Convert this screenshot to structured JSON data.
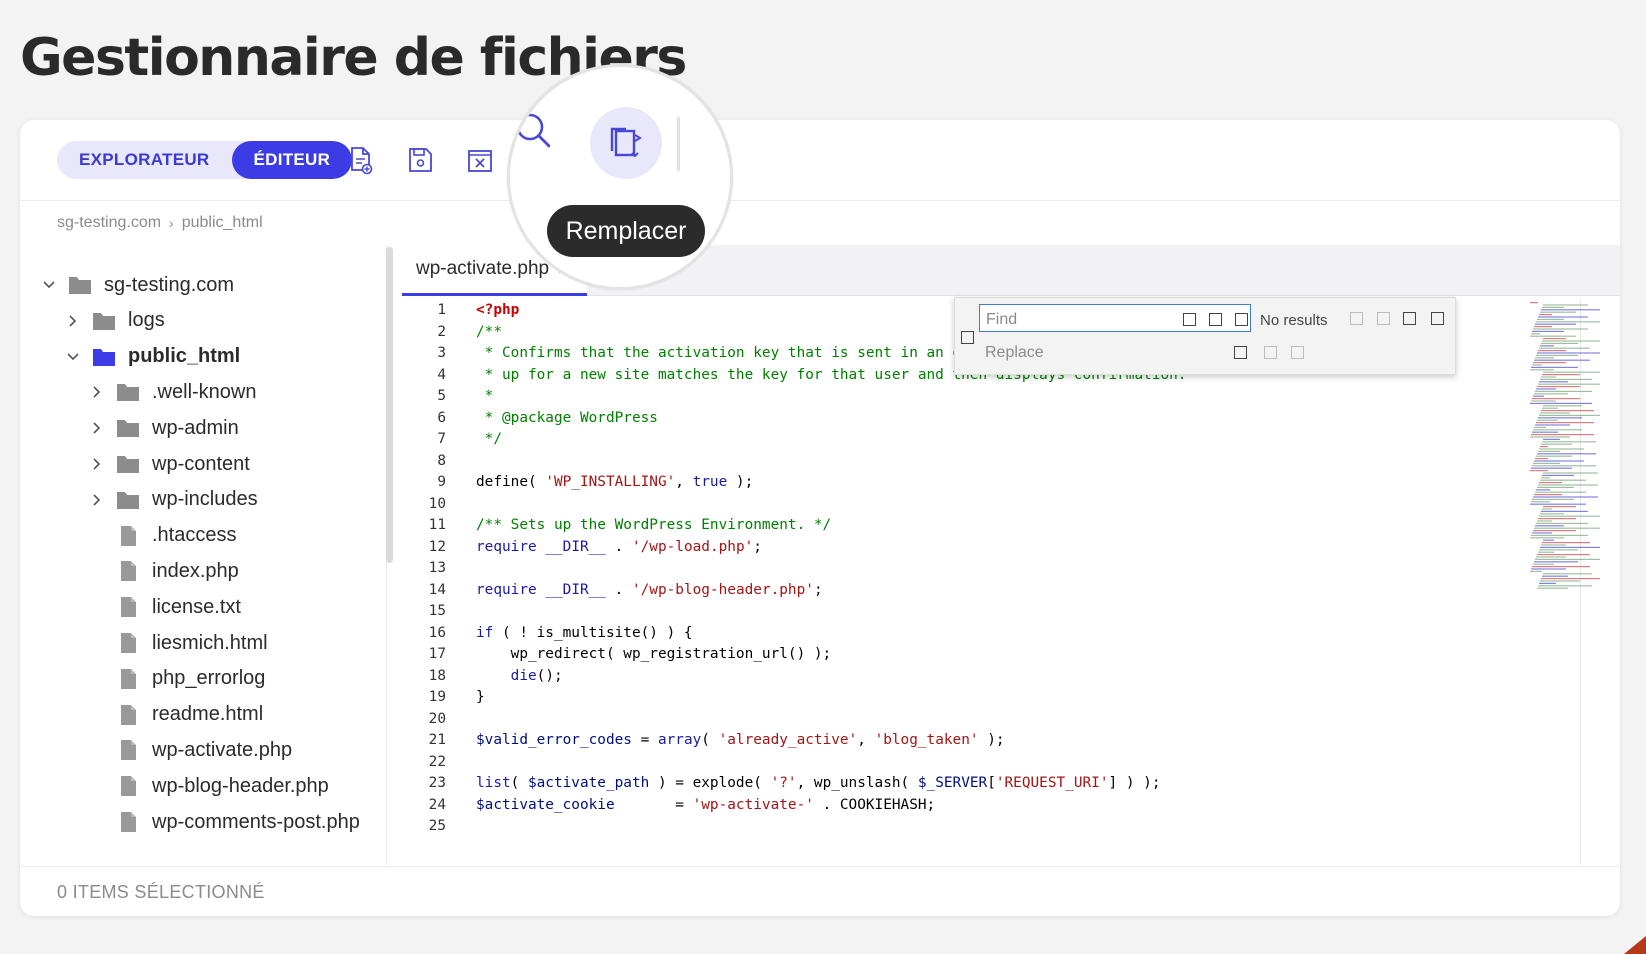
{
  "page": {
    "title": "Gestionnaire de fichiers"
  },
  "toolbar": {
    "explorer_label": "EXPLORATEUR",
    "editor_label": "ÉDITEUR",
    "icons": [
      "new-file-icon",
      "save-icon",
      "close-file-icon",
      "search-icon",
      "replace-icon"
    ],
    "tooltip": "Remplacer",
    "accent": "#3c3ce6"
  },
  "breadcrumb": {
    "root": "sg-testing.com",
    "current": "public_html"
  },
  "tree": [
    {
      "label": "sg-testing.com",
      "type": "folder",
      "depth": 0,
      "expanded": true
    },
    {
      "label": "logs",
      "type": "folder",
      "depth": 1,
      "expanded": false
    },
    {
      "label": "public_html",
      "type": "folder",
      "depth": 1,
      "expanded": true,
      "selected": true
    },
    {
      "label": ".well-known",
      "type": "folder",
      "depth": 2,
      "expanded": false
    },
    {
      "label": "wp-admin",
      "type": "folder",
      "depth": 2,
      "expanded": false
    },
    {
      "label": "wp-content",
      "type": "folder",
      "depth": 2,
      "expanded": false
    },
    {
      "label": "wp-includes",
      "type": "folder",
      "depth": 2,
      "expanded": false
    },
    {
      "label": ".htaccess",
      "type": "file",
      "depth": 2
    },
    {
      "label": "index.php",
      "type": "file",
      "depth": 2
    },
    {
      "label": "license.txt",
      "type": "file",
      "depth": 2
    },
    {
      "label": "liesmich.html",
      "type": "file",
      "depth": 2
    },
    {
      "label": "php_errorlog",
      "type": "file",
      "depth": 2
    },
    {
      "label": "readme.html",
      "type": "file",
      "depth": 2
    },
    {
      "label": "wp-activate.php",
      "type": "file",
      "depth": 2
    },
    {
      "label": "wp-blog-header.php",
      "type": "file",
      "depth": 2
    },
    {
      "label": "wp-comments-post.php",
      "type": "file",
      "depth": 2
    }
  ],
  "editor": {
    "tab_label": "wp-activate.php",
    "find": {
      "placeholder": "Find",
      "status": "No results",
      "replace_placeholder": "Replace"
    },
    "code": [
      [
        [
          "php",
          "<?php"
        ]
      ],
      [
        [
          "com",
          "/**"
        ]
      ],
      [
        [
          "com",
          " * Confirms that the activation key that is sent in an e"
        ]
      ],
      [
        [
          "com",
          " * up for a new site matches the key for that user and then displays confirmation."
        ]
      ],
      [
        [
          "com",
          " *"
        ]
      ],
      [
        [
          "com",
          " * @package WordPress"
        ]
      ],
      [
        [
          "com",
          " */"
        ]
      ],
      [],
      [
        [
          "fn",
          "define( "
        ],
        [
          "str",
          "'WP_INSTALLING'"
        ],
        [
          "fn",
          ", "
        ],
        [
          "kw",
          "true"
        ],
        [
          "fn",
          " );"
        ]
      ],
      [],
      [
        [
          "com",
          "/** Sets up the WordPress Environment. */"
        ]
      ],
      [
        [
          "kw",
          "require"
        ],
        [
          "fn",
          " "
        ],
        [
          "kw",
          "__DIR__"
        ],
        [
          "fn",
          " . "
        ],
        [
          "str",
          "'/wp-load.php'"
        ],
        [
          "fn",
          ";"
        ]
      ],
      [],
      [
        [
          "kw",
          "require"
        ],
        [
          "fn",
          " "
        ],
        [
          "kw",
          "__DIR__"
        ],
        [
          "fn",
          " . "
        ],
        [
          "str",
          "'/wp-blog-header.php'"
        ],
        [
          "fn",
          ";"
        ]
      ],
      [],
      [
        [
          "kw",
          "if"
        ],
        [
          "fn",
          " ( ! is_multisite() ) {"
        ]
      ],
      [
        [
          "fn",
          "    wp_redirect( wp_registration_url() );"
        ]
      ],
      [
        [
          "fn",
          "    "
        ],
        [
          "kw",
          "die"
        ],
        [
          "fn",
          "();"
        ]
      ],
      [
        [
          "fn",
          "}"
        ]
      ],
      [],
      [
        [
          "var",
          "$valid_error_codes"
        ],
        [
          "fn",
          " = "
        ],
        [
          "kw",
          "array"
        ],
        [
          "fn",
          "( "
        ],
        [
          "str",
          "'already_active'"
        ],
        [
          "fn",
          ", "
        ],
        [
          "str",
          "'blog_taken'"
        ],
        [
          "fn",
          " );"
        ]
      ],
      [],
      [
        [
          "kw",
          "list"
        ],
        [
          "fn",
          "( "
        ],
        [
          "var",
          "$activate_path"
        ],
        [
          "fn",
          " ) = explode( "
        ],
        [
          "str",
          "'?'"
        ],
        [
          "fn",
          ", wp_unslash( "
        ],
        [
          "var",
          "$_SERVER"
        ],
        [
          "fn",
          "["
        ],
        [
          "str",
          "'REQUEST_URI'"
        ],
        [
          "fn",
          "] ) );"
        ]
      ],
      [
        [
          "var",
          "$activate_cookie"
        ],
        [
          "fn",
          "       = "
        ],
        [
          "str",
          "'wp-activate-'"
        ],
        [
          "fn",
          " . COOKIEHASH;"
        ]
      ],
      []
    ]
  },
  "footer": {
    "status": "0 ITEMS SÉLECTIONNÉ"
  }
}
